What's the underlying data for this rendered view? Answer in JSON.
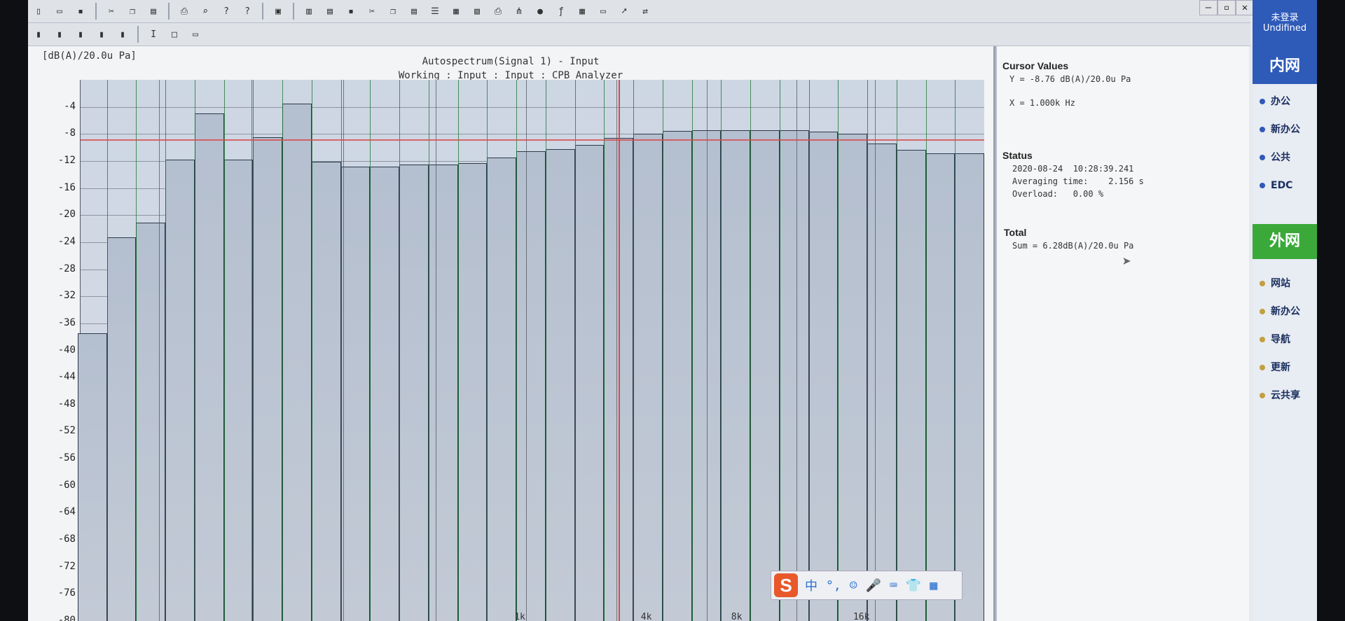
{
  "toolbar": {
    "row1_icons": [
      "new-file-icon",
      "open-icon",
      "save-icon",
      "cut-icon",
      "copy-icon",
      "paste-icon",
      "print-icon",
      "print-preview-icon",
      "help-icon",
      "context-help-icon",
      "monitor-icon",
      "book-icon",
      "doc-icon",
      "save-icon",
      "cut-icon",
      "copy-icon",
      "paste-icon",
      "list-icon",
      "grid-icon",
      "sheet-icon",
      "print-icon",
      "tree-icon",
      "database-icon",
      "function-icon",
      "table-icon",
      "window-icon",
      "arrow-icon",
      "link-icon"
    ],
    "row2_icons": [
      "bars-icon",
      "bars-icon",
      "bars-icon",
      "bars-icon",
      "bars-icon",
      "text-cursor-icon",
      "rectangle-icon",
      "screen-icon"
    ],
    "window_controls": [
      "–",
      "▫",
      "✕"
    ]
  },
  "plot": {
    "unit_label": "[dB(A)/20.0u Pa]",
    "title": "Autospectrum(Signal 1) - Input",
    "subtitle": "Working : Input : Input : CPB Analyzer",
    "y_ticks": [
      "-4",
      "-8",
      "-12",
      "-16",
      "-20",
      "-24",
      "-28",
      "-32",
      "-36",
      "-40",
      "-44",
      "-48",
      "-52",
      "-56",
      "-60",
      "-64",
      "-68",
      "-72",
      "-76",
      "-80"
    ],
    "x_ticks": [
      "1k",
      "4k",
      "8k",
      "16k"
    ]
  },
  "chart_data": {
    "type": "bar",
    "xlabel": "",
    "ylabel": "[dB(A)/20.0u Pa]",
    "ylim": [
      -80,
      0
    ],
    "categories": [
      "1",
      "2",
      "3",
      "4",
      "5",
      "6",
      "7",
      "8",
      "9",
      "10",
      "11",
      "12",
      "13",
      "14",
      "15",
      "16",
      "17",
      "18",
      "19",
      "20",
      "21",
      "22",
      "23",
      "24",
      "25",
      "26",
      "27",
      "28",
      "29",
      "30",
      "31"
    ],
    "values": [
      -37.5,
      -23.3,
      -21.1,
      -11.8,
      -5.0,
      -11.8,
      -8.5,
      -3.5,
      -12.1,
      -12.8,
      -12.8,
      -12.5,
      -12.5,
      -12.3,
      -11.5,
      -10.6,
      -10.2,
      -9.6,
      -8.6,
      -8.0,
      -7.6,
      -7.4,
      -7.4,
      -7.4,
      -7.4,
      -7.7,
      -8.0,
      -9.4,
      -10.4,
      -10.9,
      -10.9
    ],
    "cursor": {
      "x": "1.000k Hz",
      "y": -8.76
    },
    "grid": true
  },
  "info": {
    "cursor_title": "Cursor Values",
    "cursor_y": "Y = -8.76 dB(A)/20.0u Pa",
    "cursor_x": "X = 1.000k Hz",
    "status_title": "Status",
    "status_datetime": "2020-08-24  10:28:39.241",
    "status_avg": "Averaging time:    2.156 s",
    "status_overload": "Overload:   0.00 %",
    "total_title": "Total",
    "total_sum": "Sum = 6.28dB(A)/20.0u Pa"
  },
  "ime": {
    "logo": "S",
    "items": [
      "中",
      "°,",
      "☺",
      "🎤",
      "⌨",
      "👕",
      "▦"
    ]
  },
  "sidebar": {
    "login_status": "未登录",
    "login_sub": "Undifined",
    "intranet_header": "内网",
    "intranet_items": [
      "办公",
      "新办公",
      "公共",
      "EDC"
    ],
    "extranet_header": "外网",
    "extranet_items": [
      "网站",
      "新办公",
      "导航",
      "更新",
      "云共享"
    ],
    "intranet_color": "#2e5ab8",
    "extranet_color": "#3aa93a"
  }
}
